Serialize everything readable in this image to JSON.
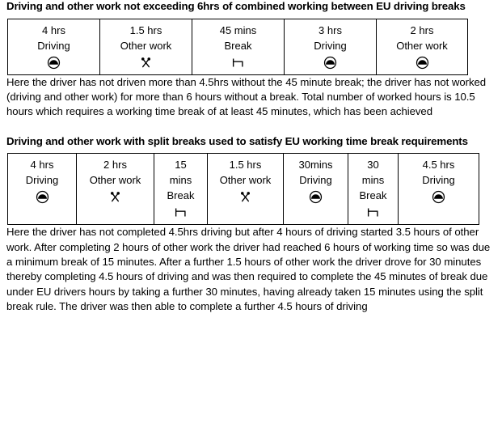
{
  "document": {
    "section1": {
      "heading": "Driving and other work not exceeding 6hrs of combined working between EU driving breaks",
      "table": {
        "columns": [
          {
            "duration": "4 hrs",
            "activity": "Driving",
            "icon": "driving-icon"
          },
          {
            "duration": "1.5 hrs",
            "activity": "Other work",
            "icon": "other-work-icon"
          },
          {
            "duration": "45 mins",
            "activity": "Break",
            "icon": "break-icon"
          },
          {
            "duration": "3 hrs",
            "activity": "Driving",
            "icon": "driving-icon"
          },
          {
            "duration": "2 hrs",
            "activity": "Other work",
            "icon": "driving-icon"
          }
        ]
      },
      "paragraph": "Here the driver has not driven more than 4.5hrs without the 45 minute break; the driver has not worked (driving and other work) for more than 6 hours without a break. Total number of worked hours is 10.5 hours which requires a working time break of at least 45 minutes, which has been achieved"
    },
    "section2": {
      "heading": "Driving and other work with split breaks used to satisfy EU working time break requirements",
      "table": {
        "columns": [
          {
            "duration": "4 hrs",
            "activity": "Driving",
            "icon": "driving-icon"
          },
          {
            "duration": "2 hrs",
            "activity": "Other work",
            "icon": "other-work-icon"
          },
          {
            "duration": "15",
            "duration2": "mins",
            "activity": "Break",
            "icon": "break-icon"
          },
          {
            "duration": "1.5 hrs",
            "activity": "Other work",
            "icon": "other-work-icon"
          },
          {
            "duration": "30mins",
            "activity": "Driving",
            "icon": "driving-icon"
          },
          {
            "duration": "30",
            "duration2": "mins",
            "activity": "Break",
            "icon": "break-icon"
          },
          {
            "duration": "4.5 hrs",
            "activity": "Driving",
            "icon": "driving-icon"
          }
        ]
      },
      "paragraph": "Here the driver has not completed 4.5hrs driving but after 4 hours of driving started 3.5 hours of other work. After completing 2 hours of other work the driver had reached 6 hours of working time so was due a minimum break of 15 minutes.  After a further 1.5 hours of other work the driver drove for 30 minutes thereby completing 4.5 hours of driving and was then required to complete the 45 minutes of break due under EU drivers hours by taking a further 30 minutes, having already taken 15 minutes using the split break rule.  The driver was then able to complete a further 4.5 hours of driving"
    }
  },
  "colors": {
    "text": "#000000",
    "background": "#ffffff",
    "border": "#000000"
  }
}
